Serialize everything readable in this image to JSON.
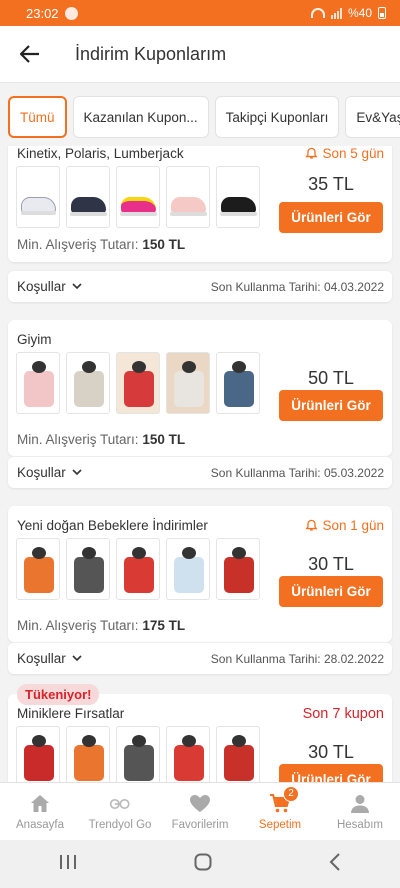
{
  "status_bar": {
    "time": "23:02",
    "battery": "%40"
  },
  "header": {
    "title": "İndirim Kuponlarım"
  },
  "tabs": [
    "Tümü",
    "Kazanılan Kupon...",
    "Takipçi Kuponları",
    "Ev&Yaş"
  ],
  "coupons": [
    {
      "title": "Kinetix, Polaris, Lumberjack",
      "expiry": "Son 5 gün",
      "amount": "35 TL",
      "button": "Ürünleri Gör",
      "min_label": "Min. Alışveriş Tutarı:",
      "min_value": "150 TL",
      "conditions": "Koşullar",
      "last_use": "Son Kullanma Tarihi: 04.03.2022"
    },
    {
      "title": "Giyim",
      "expiry": "",
      "amount": "50 TL",
      "button": "Ürünleri Gör",
      "min_label": "Min. Alışveriş Tutarı:",
      "min_value": "150 TL",
      "conditions": "Koşullar",
      "last_use": "Son Kullanma Tarihi: 05.03.2022"
    },
    {
      "title": "Yeni doğan Bebeklere İndirimler",
      "expiry": "Son 1 gün",
      "amount": "30 TL",
      "button": "Ürünleri Gör",
      "min_label": "Min. Alışveriş Tutarı:",
      "min_value": "175 TL",
      "conditions": "Koşullar",
      "last_use": "Son Kullanma Tarihi: 28.02.2022"
    },
    {
      "badge": "Tükeniyor!",
      "title": "Miniklere Fırsatlar",
      "expiry": "Son 7 kupon",
      "amount": "30 TL",
      "button": "Ürünleri Gör"
    }
  ],
  "bottom_nav": [
    {
      "label": "Anasayfa",
      "icon": "home-icon"
    },
    {
      "label": "Trendyol Go",
      "icon": "go-icon"
    },
    {
      "label": "Favorilerim",
      "icon": "heart-icon"
    },
    {
      "label": "Sepetim",
      "icon": "cart-icon",
      "badge": "2"
    },
    {
      "label": "Hesabım",
      "icon": "user-icon"
    }
  ],
  "colors": {
    "accent": "#f37021",
    "alert": "#d8232a"
  }
}
